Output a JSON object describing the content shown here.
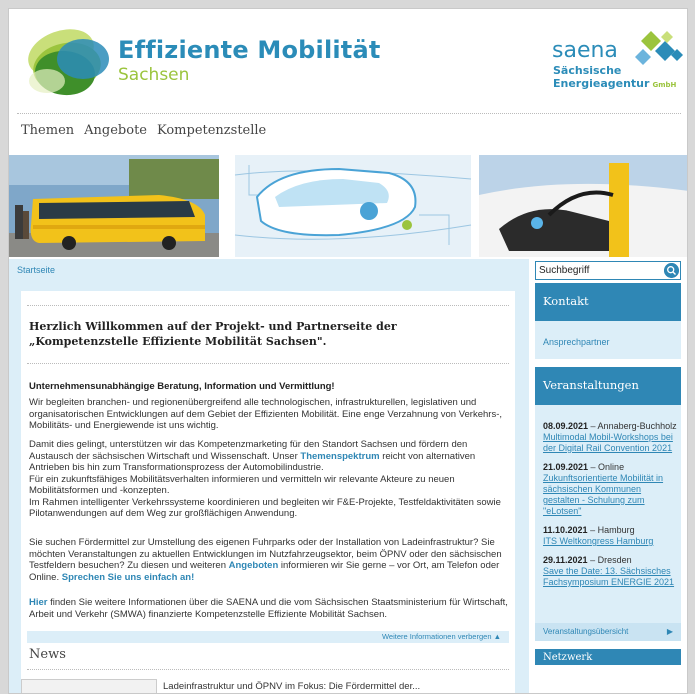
{
  "header": {
    "title": "Effiziente Mobilität",
    "subtitle": "Sachsen",
    "org_name": "saena",
    "org_line1": "Sächsische",
    "org_line2": "Energieagentur",
    "org_suffix": "GmbH"
  },
  "nav": {
    "items": [
      "Themen",
      "Angebote",
      "Kompetenzstelle"
    ]
  },
  "breadcrumb": "Startseite",
  "search": {
    "placeholder": "Suchbegriff"
  },
  "main": {
    "welcome": "Herzlich Willkommen auf der Projekt- und Partnerseite der „Kompetenzstelle Effiziente Mobilität Sachsen\".",
    "intro_heading": "Unternehmensunabhängige Beratung, Information und Vermittlung!",
    "p1": "Wir begleiten branchen- und regionenübergreifend alle technologischen, infrastrukturellen, legislativen und organisatorischen Entwicklungen auf dem Gebiet der Effizienten Mobilität. Eine enge Verzahnung von Verkehrs-, Mobilitäts- und Energiewende ist uns wichtig.",
    "p2a": "Damit dies gelingt, unterstützen wir das Kompetenzmarketing für den Standort Sachsen und fördern den Austausch der sächsischen Wirtschaft und Wissenschaft. Unser ",
    "p2_link": "Themenspektrum",
    "p2b": " reicht von alternativen Antrieben bis hin zum Transformationsprozess der Automobilindustrie.",
    "p2c": "Für ein zukunftsfähiges Mobilitätsverhalten informieren und vermitteln wir relevante Akteure zu neuen Mobilitätsformen und -konzepten.",
    "p2d": "Im Rahmen intelligenter Verkehrssysteme koordinieren und begleiten wir F&E-Projekte, Testfeldaktivitäten sowie Pilotanwendungen auf dem Weg zur großflächigen Anwendung.",
    "p3a": "Sie suchen Fördermittel zur Umstellung des eigenen Fuhrparks oder der Installation von Ladeinfrastruktur? Sie möchten Veranstaltungen zu aktuellen Entwicklungen im Nutzfahrzeugsektor, beim ÖPNV oder den sächsischen Testfeldern besuchen? Zu diesen und weiteren ",
    "p3_link": "Angeboten",
    "p3b": " informieren wir Sie gerne – vor Ort, am Telefon oder Online. ",
    "p3_link2": "Sprechen Sie uns einfach an!",
    "p4_link": "Hier",
    "p4": " finden Sie weitere Informationen über die SAENA und die vom Sächsischen Staatsministerium für Wirtschaft, Arbeit und Verkehr (SMWA) finanzierte Kompetenzstelle Effiziente Mobilität Sachsen.",
    "more_link": "Weitere Informationen verbergen ▲",
    "news_title": "News",
    "news_teaser": "Ladeinfrastruktur und ÖPNV im Fokus: Die Fördermittel der..."
  },
  "sidebar": {
    "kontakt_title": "Kontakt",
    "kontakt_link": "Ansprechpartner",
    "events_title": "Veranstaltungen",
    "events": [
      {
        "date": "08.09.2021",
        "place": " – Annaberg-Buchholz",
        "title": "Multimodal Mobil-Workshops bei der Digital Rail Convention 2021"
      },
      {
        "date": "21.09.2021",
        "place": " – Online",
        "title": "Zukunftsorientierte Mobilität in sächsischen Kommunen gestalten - Schulung zum \"eLotsen\""
      },
      {
        "date": "11.10.2021",
        "place": " – Hamburg",
        "title": "ITS Weltkongress Hamburg"
      },
      {
        "date": "29.11.2021",
        "place": " – Dresden",
        "title": "Save the Date: 13. Sächsisches Fachsymposium ENERGIE 2021"
      }
    ],
    "events_footer": "Veranstaltungsübersicht",
    "netzwerk_title": "Netzwerk"
  },
  "colors": {
    "brand_blue": "#2f87b5",
    "brand_green": "#9bc43d",
    "light_blue": "#dceef8"
  }
}
